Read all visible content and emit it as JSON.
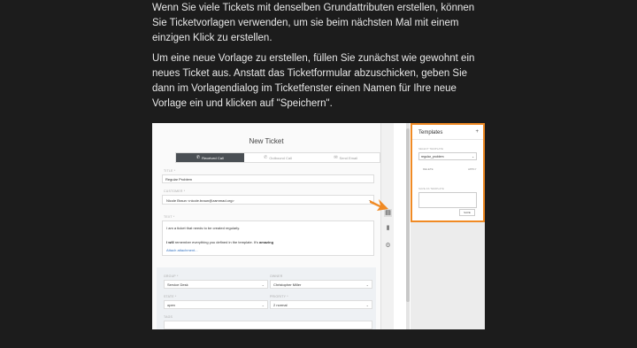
{
  "article": {
    "paragraph1": "Wenn Sie viele Tickets mit denselben Grundattributen erstellen, können Sie Ticketvorlagen verwenden, um sie beim nächsten Mal mit einem einzigen Klick zu erstellen.",
    "paragraph2": "Um eine neue Vorlage zu erstellen, füllen Sie zunächst wie gewohnt ein neues Ticket aus. Anstatt das Ticketformular abzuschicken, geben Sie dann im Vorlagendialog im Ticketfenster einen Namen für Ihre neue Vorlage ein und klicken auf \"Speichern\"."
  },
  "screenshot": {
    "ticket": {
      "title": "New Ticket",
      "types": [
        "Received Call",
        "Outbound Call",
        "Send Email"
      ],
      "title_label": "TITLE *",
      "title_value": "Regular Problem",
      "customer_label": "CUSTOMER *",
      "customer_value": "Nicole Braun <nicole.braun@zammad.org>",
      "text_label": "TEXT *",
      "text_line1": "I am a ticket that needs to be created regularly.",
      "text_line2_prefix": "I will",
      "text_line2_suffix": " remember everything you defined in the template. It's ",
      "text_line2_bold": "amazing",
      "attachment_link": "Attach attachment...",
      "group_label": "GROUP *",
      "group_value": "Service Desk",
      "owner_label": "OWNER",
      "owner_value": "Christopher Miller",
      "state_label": "STATE *",
      "state_value": "open",
      "priority_label": "PRIORITY *",
      "priority_value": "2 normal",
      "tags_label": "TAGS"
    },
    "templates": {
      "heading": "Templates",
      "plus": "+",
      "load_label": "SELECT TEMPLATE",
      "selected": "regular_problem",
      "delete_label": "DELETE",
      "apply_label": "APPLY",
      "save_as_label": "SAVE AS TEMPLATE",
      "save_label": "SAVE"
    },
    "colors": {
      "highlight": "#f08a24",
      "active_tab": "#4a4f54"
    }
  }
}
